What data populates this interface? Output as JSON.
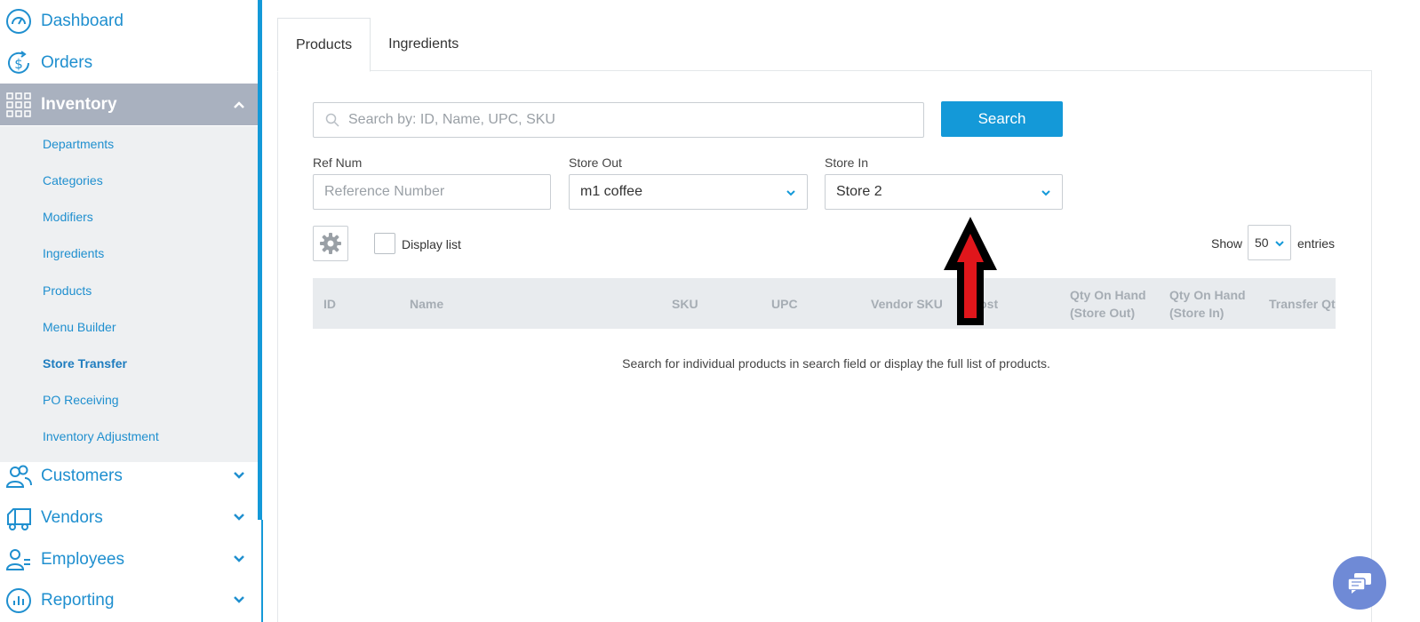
{
  "sidebar": {
    "items": [
      {
        "label": "Dashboard",
        "icon": "gauge-icon"
      },
      {
        "label": "Orders",
        "icon": "dollar-cycle-icon"
      },
      {
        "label": "Inventory",
        "icon": "grid-icon",
        "expanded": true
      },
      {
        "label": "Customers",
        "icon": "users-icon"
      },
      {
        "label": "Vendors",
        "icon": "truck-icon"
      },
      {
        "label": "Employees",
        "icon": "employees-icon"
      },
      {
        "label": "Reporting",
        "icon": "chart-icon"
      }
    ],
    "inventory_sub": [
      "Departments",
      "Categories",
      "Modifiers",
      "Ingredients",
      "Products",
      "Menu Builder",
      "Store Transfer",
      "PO Receiving",
      "Inventory Adjustment"
    ],
    "current_sub": "Store Transfer"
  },
  "tabs": [
    "Products",
    "Ingredients"
  ],
  "active_tab": "Products",
  "search": {
    "placeholder": "Search by: ID, Name, UPC, SKU",
    "button": "Search"
  },
  "filters": {
    "ref_num": {
      "label": "Ref Num",
      "placeholder": "Reference Number"
    },
    "store_out": {
      "label": "Store Out",
      "value": "m1 coffee"
    },
    "store_in": {
      "label": "Store In",
      "value": "Store 2"
    }
  },
  "display_list": {
    "label": "Display list",
    "checked": false
  },
  "pagination": {
    "show_label": "Show",
    "page_size": "50",
    "entries_label": "entries"
  },
  "table": {
    "columns": [
      {
        "l1": "ID"
      },
      {
        "l1": "Name"
      },
      {
        "l1": "SKU"
      },
      {
        "l1": "UPC"
      },
      {
        "l1": "Vendor SKU"
      },
      {
        "l1": "Cost"
      },
      {
        "l1": "Qty On Hand",
        "l2": "(Store Out)"
      },
      {
        "l1": "Qty On Hand",
        "l2": "(Store In)"
      },
      {
        "l1": "Transfer Qty"
      }
    ],
    "empty_message": "Search for individual products in search field or display the full list of products."
  },
  "colors": {
    "accent": "#1499d8",
    "sidebar_active": "#a9b1bf",
    "chat": "#6f8ad6",
    "arrow": "#e0161b"
  }
}
